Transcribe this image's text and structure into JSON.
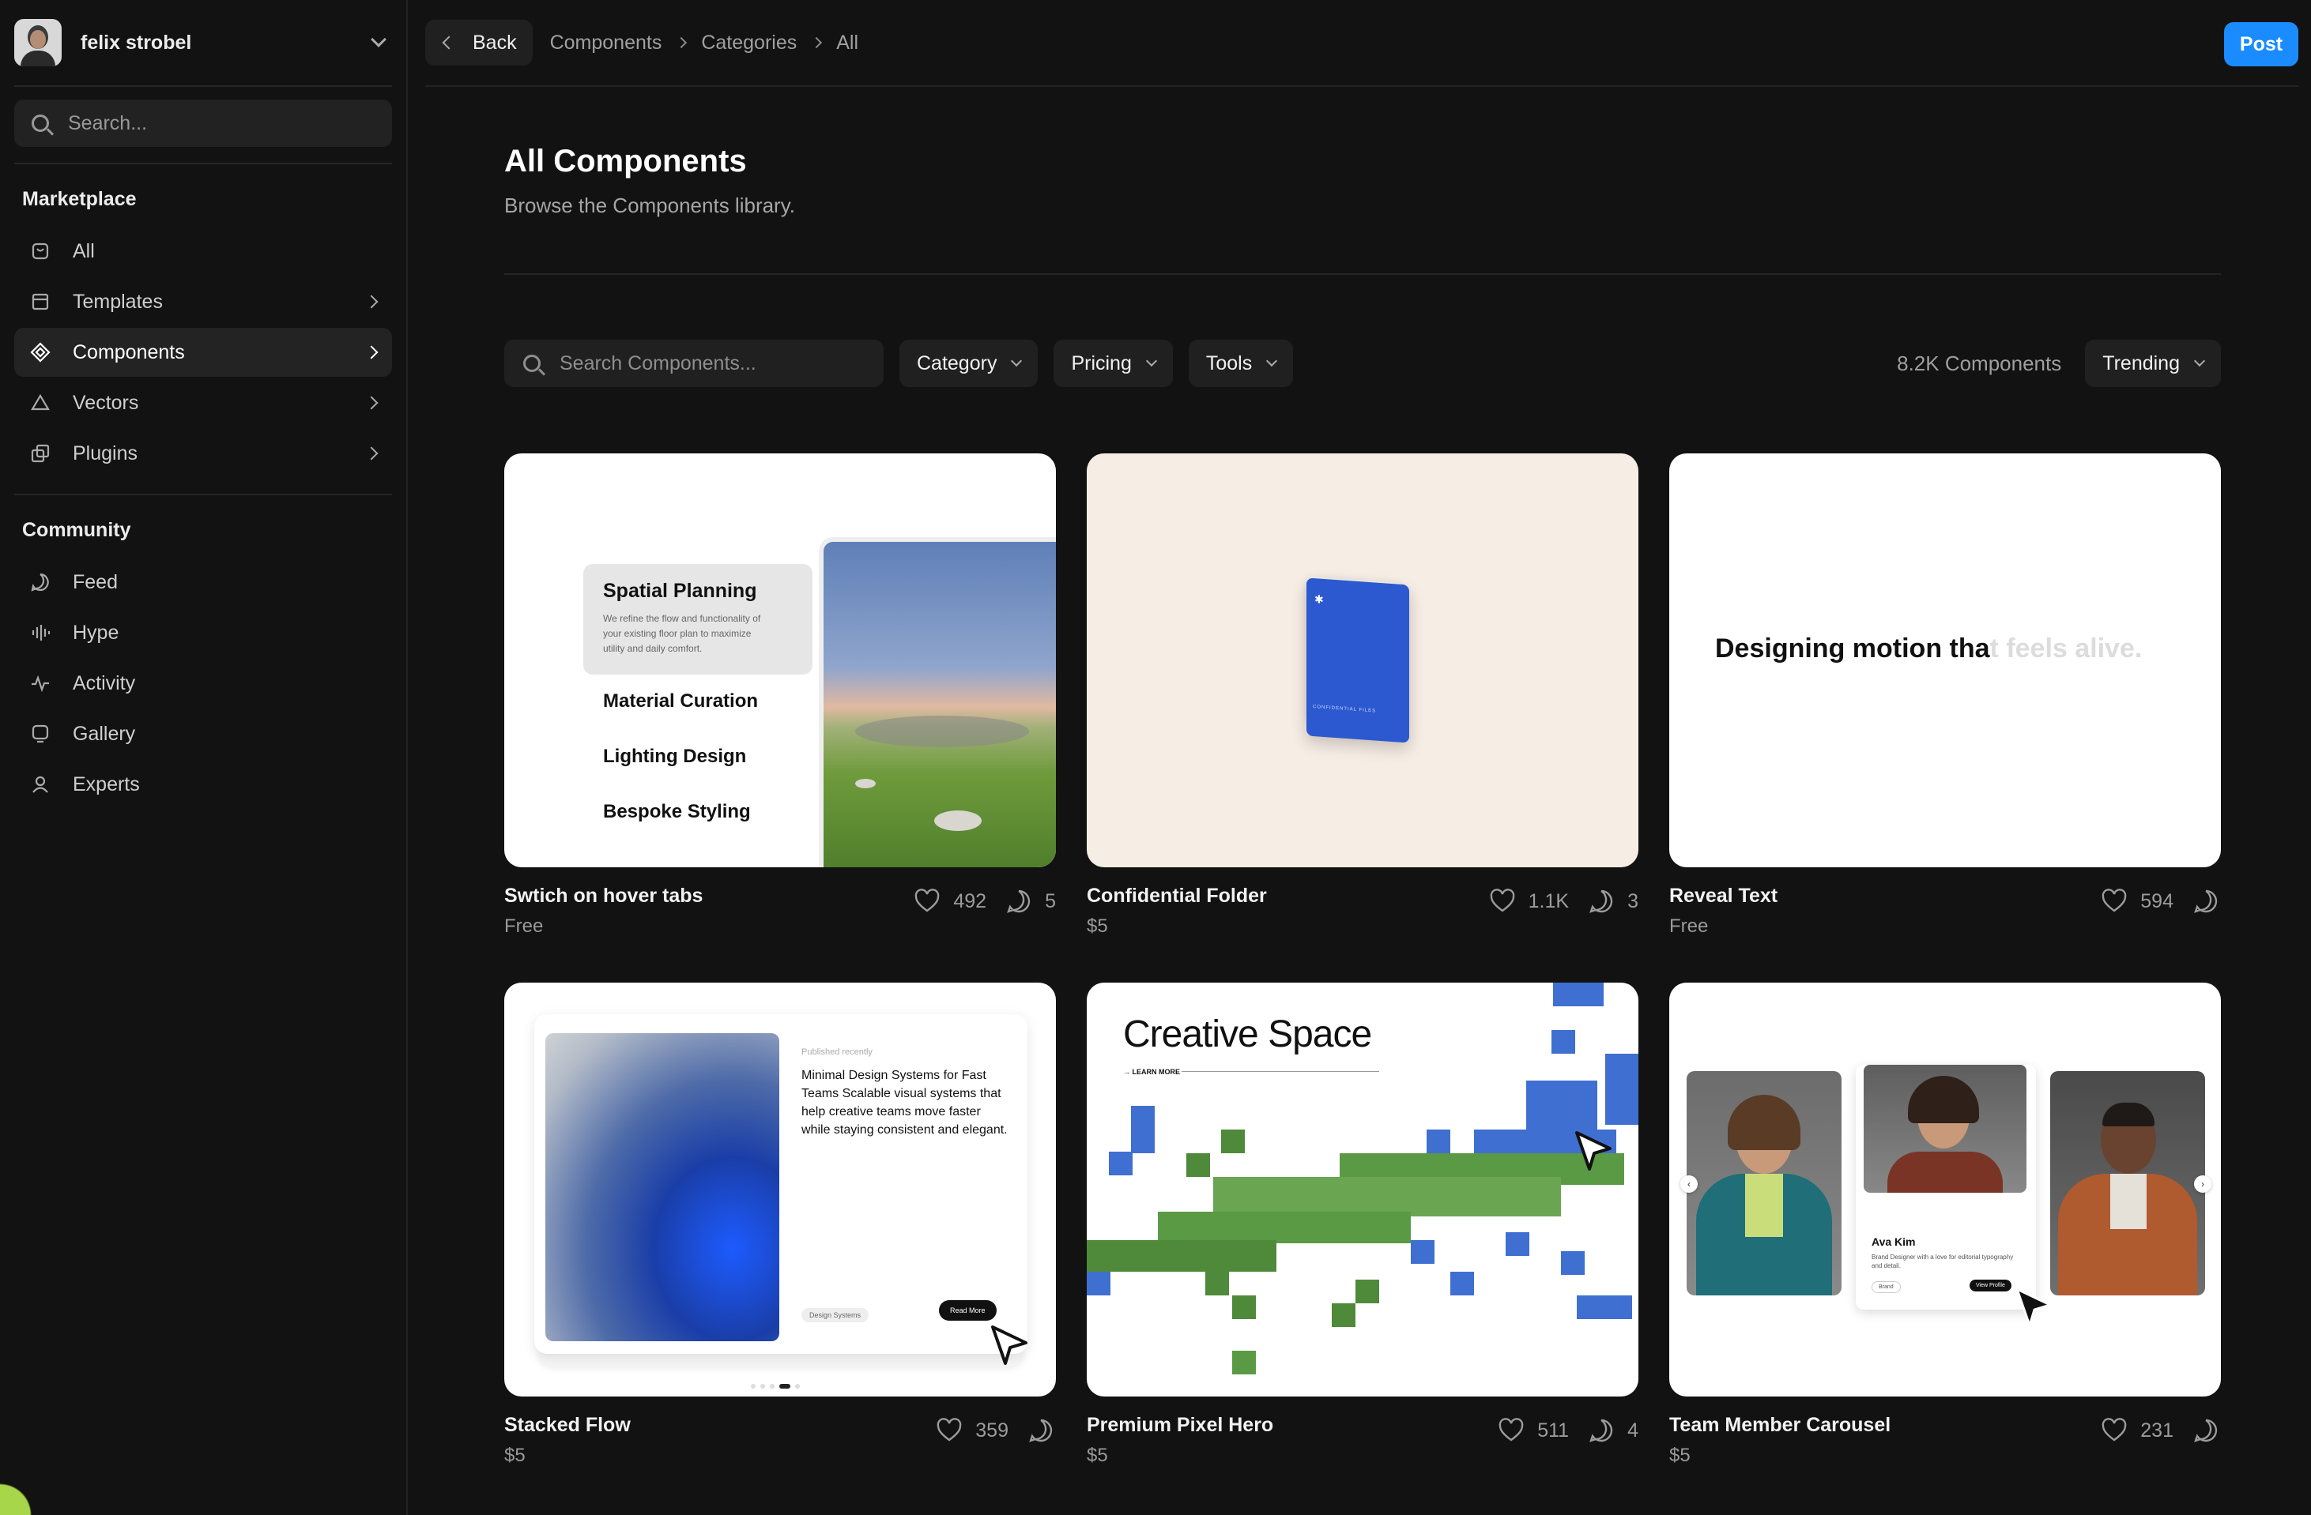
{
  "user": {
    "name": "felix strobel"
  },
  "sidebar": {
    "search_placeholder": "Search...",
    "marketplace_title": "Marketplace",
    "marketplace_items": [
      {
        "label": "All",
        "icon": "store-icon"
      },
      {
        "label": "Templates",
        "icon": "layout-icon"
      },
      {
        "label": "Components",
        "icon": "component-icon"
      },
      {
        "label": "Vectors",
        "icon": "triangle-icon"
      },
      {
        "label": "Plugins",
        "icon": "plugin-icon"
      }
    ],
    "community_title": "Community",
    "community_items": [
      {
        "label": "Feed",
        "icon": "chat-bubble-icon"
      },
      {
        "label": "Hype",
        "icon": "audio-bars-icon"
      },
      {
        "label": "Activity",
        "icon": "pulse-icon"
      },
      {
        "label": "Gallery",
        "icon": "gallery-icon"
      },
      {
        "label": "Experts",
        "icon": "user-icon"
      }
    ]
  },
  "topbar": {
    "back_label": "Back",
    "breadcrumbs": [
      "Components",
      "Categories",
      "All"
    ],
    "post_label": "Post",
    "accent": "#1a8cff"
  },
  "page": {
    "title": "All Components",
    "subtitle": "Browse the Components library.",
    "search_placeholder": "Search Components...",
    "filters": [
      "Category",
      "Pricing",
      "Tools"
    ],
    "count": "8.2K Components",
    "sort": "Trending"
  },
  "cards": [
    {
      "title": "Swtich on hover tabs",
      "price": "Free",
      "likes": "492",
      "comments": "5",
      "preview": {
        "tab_title": "Spatial Planning",
        "tab_desc": "We refine the flow and functionality of your existing floor plan to maximize utility and daily comfort.",
        "tabs": [
          "Material Curation",
          "Lighting Design",
          "Bespoke Styling"
        ]
      }
    },
    {
      "title": "Confidential Folder",
      "price": "$5",
      "likes": "1.1K",
      "comments": "3",
      "preview": {
        "folder_label": "CONFIDENTIAL FILES"
      }
    },
    {
      "title": "Reveal Text",
      "price": "Free",
      "likes": "594",
      "comments": "",
      "preview": {
        "text_visible": "Designing motion tha",
        "text_faded": "t feels alive."
      }
    },
    {
      "title": "Stacked Flow",
      "price": "$5",
      "likes": "359",
      "comments": "",
      "preview": {
        "meta": "Published recently",
        "headline": "Minimal Design Systems for Fast Teams Scalable visual systems that help creative teams move faster while staying consistent and elegant.",
        "tag": "Design Systems",
        "button": "Read More"
      }
    },
    {
      "title": "Premium Pixel Hero",
      "price": "$5",
      "likes": "511",
      "comments": "4",
      "preview": {
        "headline": "Creative Space",
        "link": "→ LEARN MORE"
      }
    },
    {
      "title": "Team Member Carousel",
      "price": "$5",
      "likes": "231",
      "comments": "",
      "preview": {
        "name": "Ava Kim",
        "role": "Brand Designer with a love for editorial typography and detail.",
        "tag": "Brand",
        "button": "View Profile"
      }
    }
  ]
}
